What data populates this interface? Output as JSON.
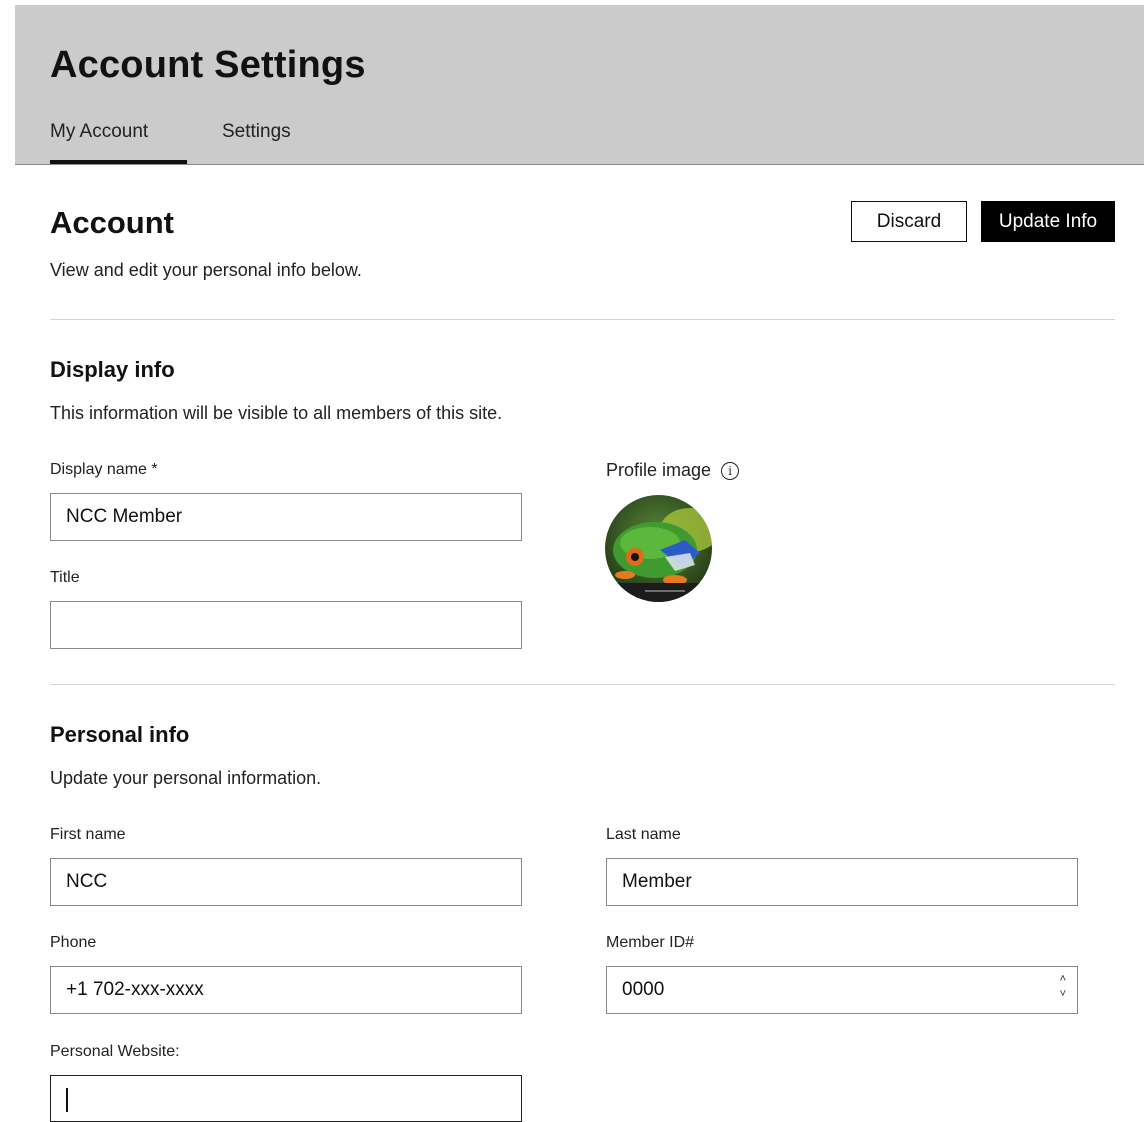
{
  "header": {
    "title": "Account Settings",
    "tabs": [
      {
        "label": "My Account",
        "active": true
      },
      {
        "label": "Settings",
        "active": false
      }
    ]
  },
  "account": {
    "title": "Account",
    "subtitle": "View and edit your personal info below.",
    "discard_label": "Discard",
    "update_label": "Update Info"
  },
  "display_info": {
    "title": "Display info",
    "subtitle": "This information will be visible to all members of this site.",
    "display_name_label": "Display name *",
    "display_name_value": "NCC Member",
    "title_label": "Title",
    "title_value": "",
    "profile_image_label": "Profile image",
    "info_glyph": "i"
  },
  "personal_info": {
    "title": "Personal info",
    "subtitle": "Update your personal information.",
    "first_name_label": "First name",
    "first_name_value": "NCC",
    "last_name_label": "Last name",
    "last_name_value": "Member",
    "phone_label": "Phone",
    "phone_value": "+1 702-xxx-xxxx",
    "member_id_label": "Member ID#",
    "member_id_value": "0000",
    "website_label": "Personal Website:",
    "website_value": ""
  },
  "icons": {
    "info": "info-circle-icon",
    "stepper_up": "chevron-up-icon",
    "stepper_down": "chevron-down-icon",
    "avatar": "frog-avatar-image"
  },
  "colors": {
    "header_bg": "#cbcbcb",
    "primary_button": "#000000",
    "text": "#111111"
  }
}
